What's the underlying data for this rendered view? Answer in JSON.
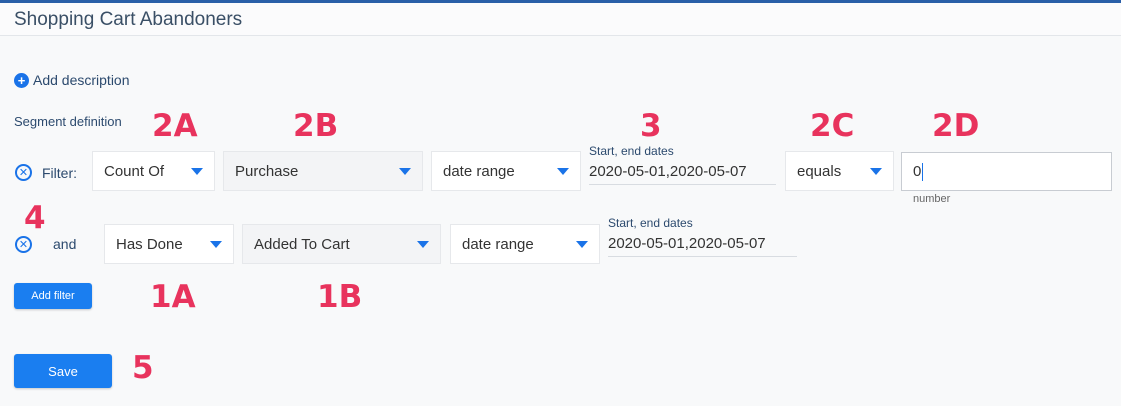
{
  "header": {
    "title": "Shopping Cart Abandoners"
  },
  "description": {
    "add_label": "Add description"
  },
  "segment": {
    "heading": "Segment definition",
    "filter_row": {
      "label": "Filter:",
      "aggregation": "Count Of",
      "event": "Purchase",
      "range_type": "date range",
      "date_label": "Start, end dates",
      "date_value": "2020-05-01,2020-05-07",
      "operator": "equals",
      "number_value": "0",
      "number_hint": "number"
    },
    "and_row": {
      "label": "and",
      "condition": "Has Done",
      "event": "Added To Cart",
      "range_type": "date range",
      "date_label": "Start, end dates",
      "date_value": "2020-05-01,2020-05-07"
    },
    "add_filter_label": "Add filter"
  },
  "save_label": "Save",
  "annotations": {
    "a2A": "2A",
    "a2B": "2B",
    "a3": "3",
    "a2C": "2C",
    "a2D": "2D",
    "a4": "4",
    "a1A": "1A",
    "a1B": "1B",
    "a5": "5"
  },
  "icons": {
    "add": "plus-circle-icon",
    "remove": "close-circle-icon",
    "dropdown": "caret-down-icon"
  },
  "colors": {
    "accent": "#1a73e8",
    "button": "#1a7ef0",
    "annotation": "#e8335d",
    "top_border": "#2a5fa8"
  }
}
